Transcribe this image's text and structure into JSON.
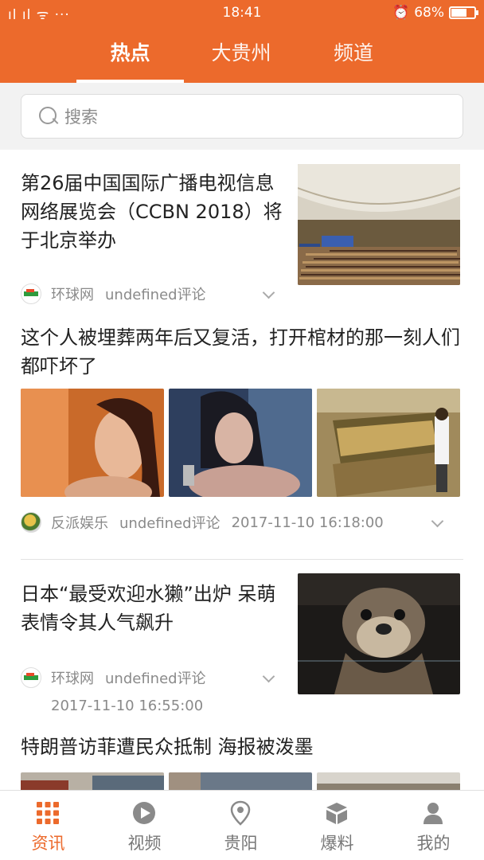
{
  "status_bar": {
    "signal": "2G 4G",
    "time": "18:41",
    "battery": "68%",
    "battery_level": 0.68
  },
  "header": {
    "tabs": [
      {
        "label": "热点",
        "active": true
      },
      {
        "label": "大贵州",
        "active": false
      },
      {
        "label": "频道",
        "active": false
      }
    ]
  },
  "search": {
    "placeholder": "搜索"
  },
  "feed": {
    "articles": [
      {
        "title": "第26届中国国际广播电视信息网络展览会（CCBN 2018）将于北京举办",
        "source": "环球网",
        "comments": "undefined评论",
        "timestamp": ""
      },
      {
        "title": "这个人被埋葬两年后又复活，打开棺材的那一刻人们都吓坏了",
        "source": "反派娱乐",
        "comments": "undefined评论",
        "timestamp": "2017-11-10 16:18:00"
      },
      {
        "title": "日本“最受欢迎水獭”出炉 呆萌表情令其人气飙升",
        "source": "环球网",
        "comments": "undefined评论",
        "timestamp": "2017-11-10 16:55:00"
      },
      {
        "title": "特朗普访菲遭民众抵制 海报被泼墨",
        "source": "",
        "comments": "",
        "timestamp": ""
      }
    ]
  },
  "bottom_nav": {
    "items": [
      {
        "label": "资讯",
        "icon": "grid-icon",
        "active": true
      },
      {
        "label": "视频",
        "icon": "play-icon",
        "active": false
      },
      {
        "label": "贵阳",
        "icon": "location-pin-icon",
        "active": false
      },
      {
        "label": "爆料",
        "icon": "box-icon",
        "active": false
      },
      {
        "label": "我的",
        "icon": "user-icon",
        "active": false
      }
    ]
  },
  "colors": {
    "accent": "#ec6a2c",
    "text": "#222222",
    "meta": "#8a8a8a"
  }
}
